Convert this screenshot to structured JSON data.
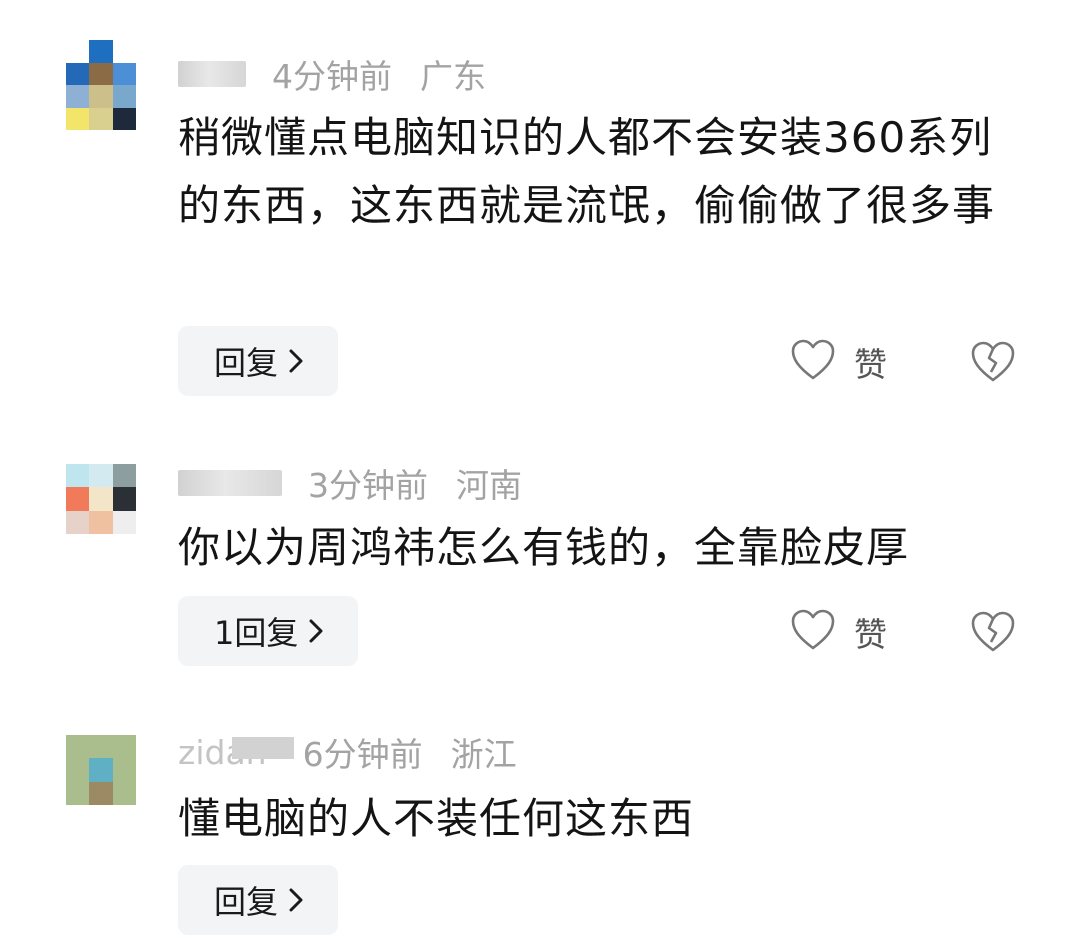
{
  "comments": [
    {
      "username": "",
      "time": "4分钟前",
      "location": "广东",
      "text": "稍微懂点电脑知识的人都不会安装360系列的东西，这东西就是流氓，偷偷做了很多事",
      "reply_label": "回复",
      "like_label": "赞",
      "avatar_colors": [
        "#ffffff",
        "#1f6fc0",
        "#ffffff",
        "#2469b8",
        "#8b6b45",
        "#4c8fd6",
        "#8db0d4",
        "#cdbf8a",
        "#7aa7cc",
        "#f3e56a",
        "#d9cf8e",
        "#1e2a3c"
      ]
    },
    {
      "username": "",
      "time": "3分钟前",
      "location": "河南",
      "text": "你以为周鸿祎怎么有钱的，全靠脸皮厚",
      "reply_label": "1回复",
      "like_label": "赞",
      "avatar_colors": [
        "#bfe6ee",
        "#d2eaf0",
        "#8c9ea0",
        "#f07a5a",
        "#f3e6c8",
        "#2b2f36",
        "#e6d2c9",
        "#efc1a0",
        "#eeeeee"
      ]
    },
    {
      "username": "zidan",
      "time": "6分钟前",
      "location": "浙江",
      "text": "懂电脑的人不装任何这东西",
      "reply_label": "回复",
      "like_label": "",
      "avatar_colors": [
        "#a9be8c",
        "#a9be8c",
        "#a9be8c",
        "#a9be8c",
        "#5fb0c4",
        "#a9be8c",
        "#a9be8c",
        "#9c8a64",
        "#a9be8c"
      ]
    }
  ],
  "icons": {
    "like": "heart-outline-icon",
    "dislike": "broken-heart-icon",
    "chevron": "chevron-right-icon"
  }
}
